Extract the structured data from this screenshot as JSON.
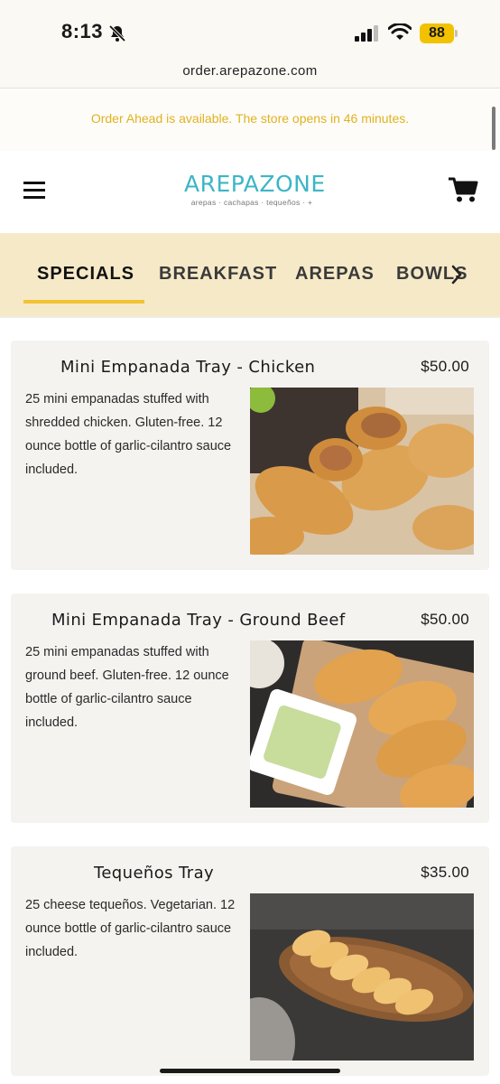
{
  "status_bar": {
    "time": "8:13",
    "battery_percent": "88",
    "icons": [
      "bell-slash-icon",
      "signal-icon",
      "wifi-icon",
      "battery-icon"
    ]
  },
  "browser": {
    "url": "order.arepazone.com"
  },
  "notice": {
    "text": "Order Ahead is available. The store opens in 46 minutes."
  },
  "header": {
    "logo_title": "AREPAZONE",
    "logo_tagline": "arepas · cachapas · tequeños · +",
    "menu_icon": "hamburger-menu-icon",
    "cart_icon": "shopping-cart-icon"
  },
  "tabs": {
    "items": [
      "SPECIALS",
      "BREAKFAST",
      "AREPAS",
      "BOWLS"
    ],
    "active": "SPECIALS",
    "scroll_icon": "chevron-right-icon"
  },
  "menu_items": [
    {
      "title": "Mini Empanada Tray - Chicken",
      "price": "$50.00",
      "description": "25 mini empanadas stuffed with shredded chicken. Gluten-free. 12 ounce bottle of garlic-cilantro sauce included."
    },
    {
      "title": "Mini Empanada Tray - Ground Beef",
      "price": "$50.00",
      "description": "25 mini empanadas stuffed with ground beef. Gluten-free. 12 ounce bottle of garlic-cilantro sauce included."
    },
    {
      "title": "Tequeños Tray",
      "price": "$35.00",
      "description": "25 cheese tequeños. Vegetarian. 12 ounce bottle of garlic-cilantro sauce included."
    }
  ],
  "colors": {
    "accent_yellow": "#f1c233",
    "notice_text": "#e0b21e",
    "tab_bar_bg": "#f6e9c7",
    "logo_teal": "#3cb6c6",
    "card_bg": "#f4f3f0"
  }
}
